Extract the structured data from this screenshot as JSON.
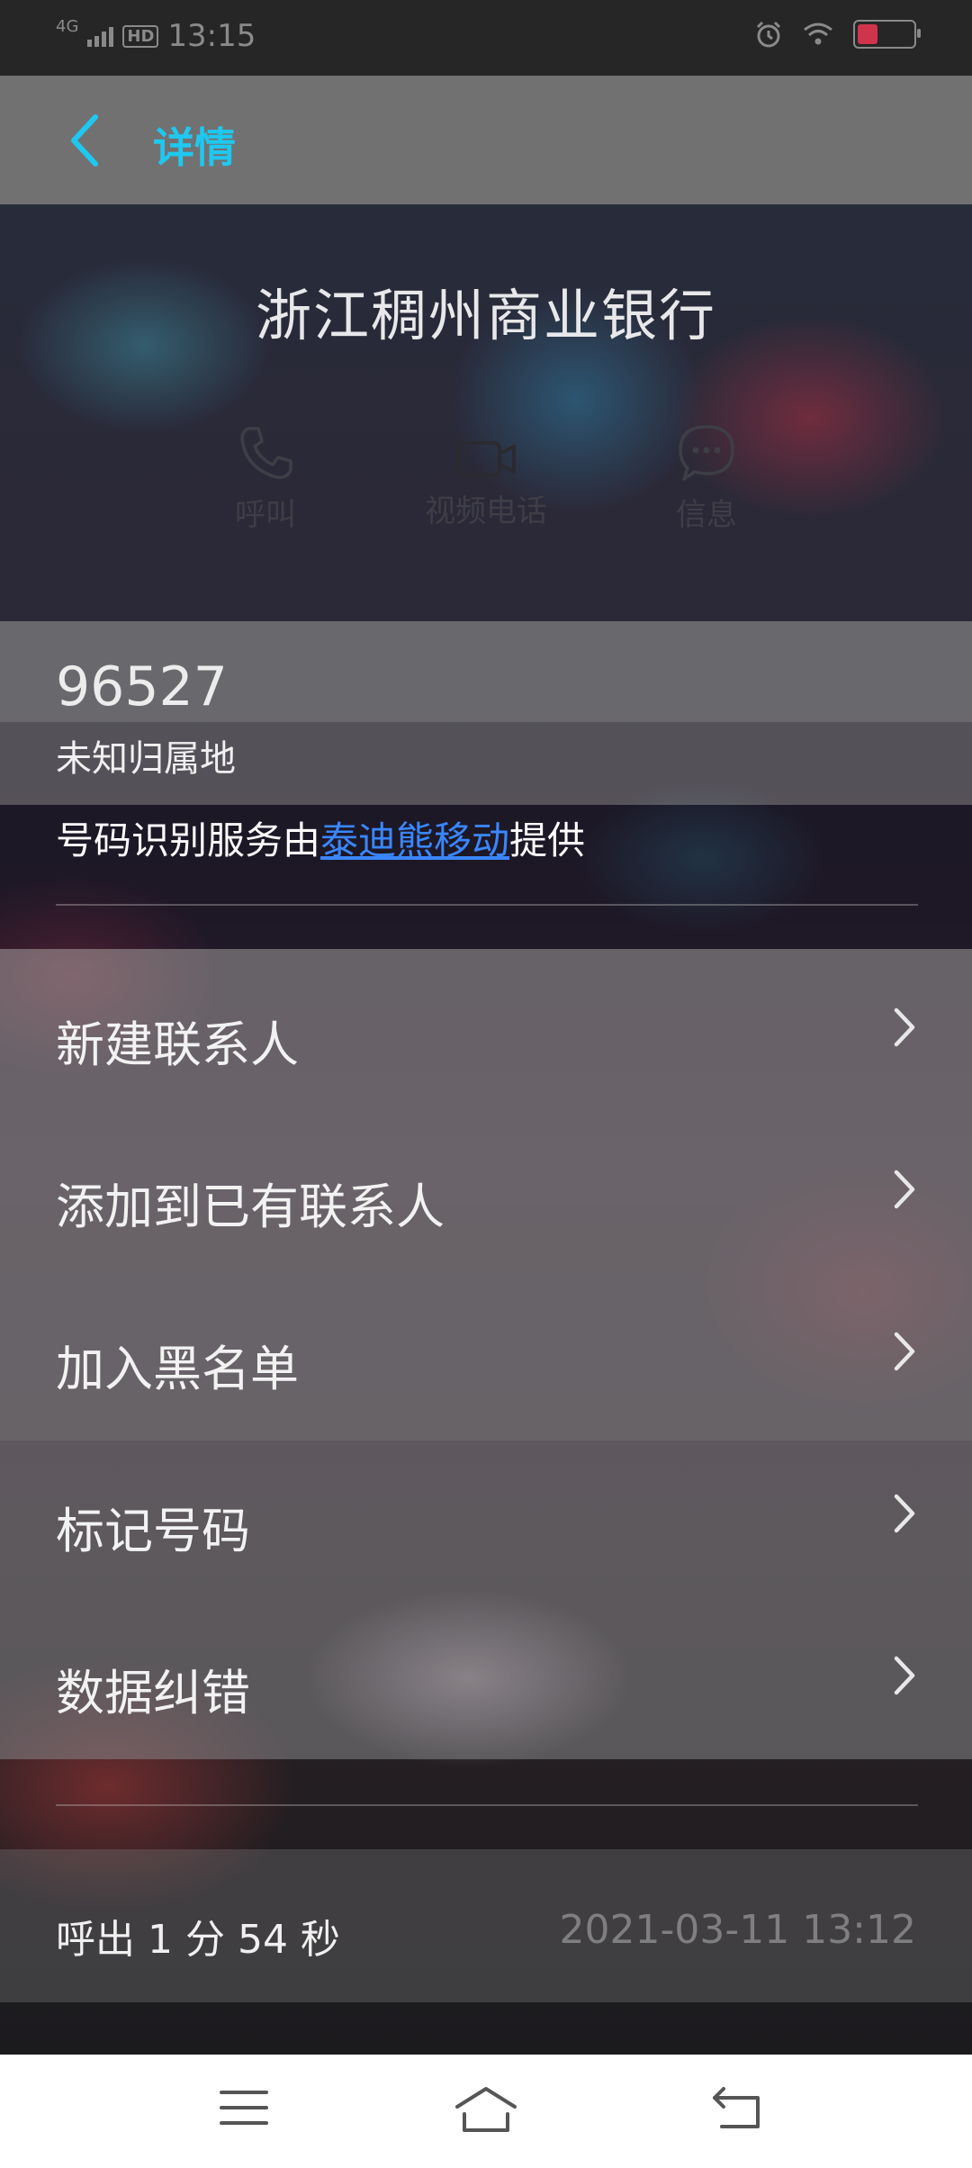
{
  "status_bar": {
    "network": "4G",
    "hd": "HD",
    "time": "13:15",
    "icons": [
      "signal-icon",
      "alarm-icon",
      "wifi-icon",
      "battery-icon"
    ]
  },
  "header": {
    "title": "详情",
    "back_icon": "chevron-left-icon",
    "accent_color": "#1fc8f0"
  },
  "contact": {
    "name": "浙江稠州商业银行",
    "actions": [
      {
        "label": "呼叫",
        "icon": "phone-icon"
      },
      {
        "label": "视频电话",
        "icon": "video-camera-icon"
      },
      {
        "label": "信息",
        "icon": "message-bubble-icon"
      }
    ],
    "number": "96527",
    "region": "未知归属地",
    "provider_prefix": "号码识别服务由",
    "provider_link": "泰迪熊移动",
    "provider_suffix": "提供"
  },
  "menu": {
    "items": [
      {
        "label": "新建联系人"
      },
      {
        "label": "添加到已有联系人"
      },
      {
        "label": "加入黑名单"
      },
      {
        "label": "标记号码"
      },
      {
        "label": "数据纠错"
      }
    ]
  },
  "call_log": {
    "duration": "呼出 1 分 54 秒",
    "datetime": "2021-03-11 13:12"
  },
  "nav_bar": {
    "buttons": [
      "menu-icon",
      "home-icon",
      "back-icon"
    ]
  }
}
